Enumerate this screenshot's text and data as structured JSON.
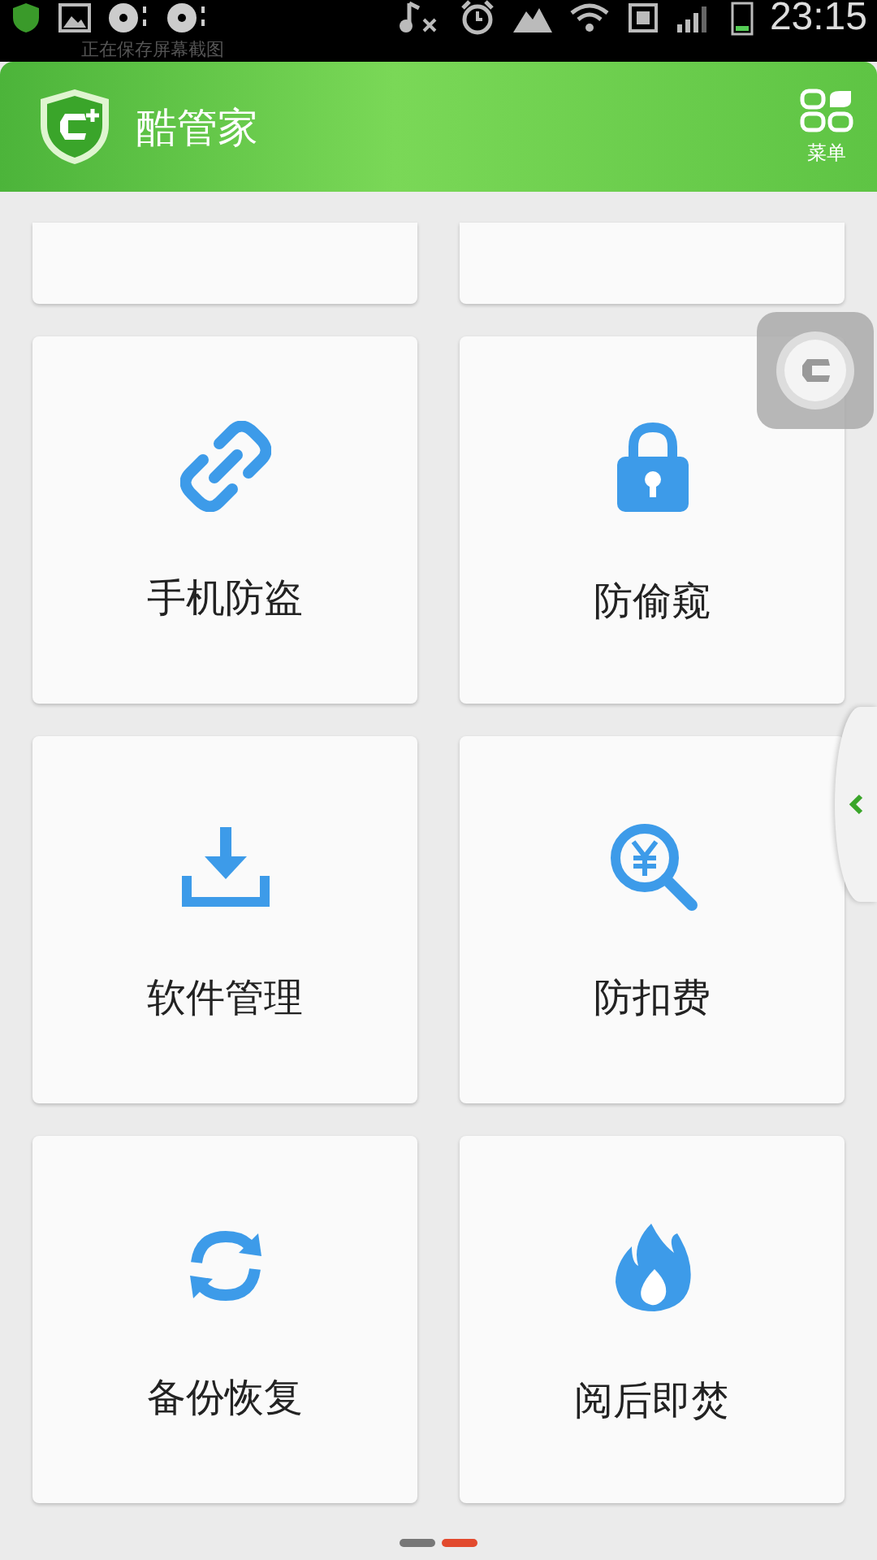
{
  "status_bar": {
    "time": "23:15"
  },
  "notification": {
    "text": "正在保存屏幕截图"
  },
  "header": {
    "title": "酷管家",
    "menu_label": "菜单"
  },
  "tiles": [
    {
      "label": "手机防盗",
      "kind": "link"
    },
    {
      "label": "防偷窥",
      "kind": "lock"
    },
    {
      "label": "软件管理",
      "kind": "download"
    },
    {
      "label": "防扣费",
      "kind": "yen-search"
    },
    {
      "label": "备份恢复",
      "kind": "sync"
    },
    {
      "label": "阅后即焚",
      "kind": "flame"
    }
  ],
  "pages": [
    {
      "selected": false
    },
    {
      "selected": true
    }
  ]
}
